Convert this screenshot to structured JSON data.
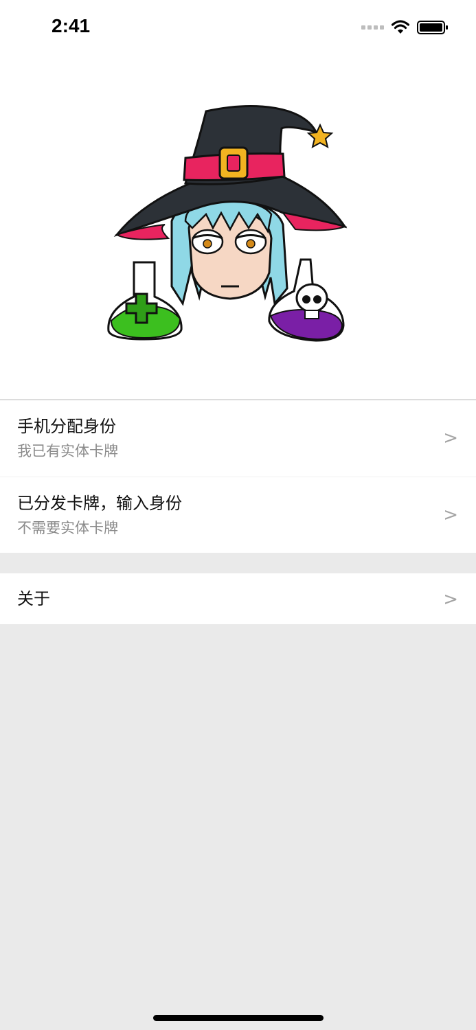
{
  "status_bar": {
    "time": "2:41",
    "icons": [
      "signal-icon",
      "wifi-icon",
      "battery-icon"
    ]
  },
  "hero": {
    "image": "witch-illustration"
  },
  "menu": {
    "group1": [
      {
        "title": "手机分配身份",
        "subtitle": "我已有实体卡牌",
        "chevron": ">"
      },
      {
        "title": "已分发卡牌，输入身份",
        "subtitle": "不需要实体卡牌",
        "chevron": ">"
      }
    ],
    "group2": [
      {
        "title": "关于",
        "chevron": ">"
      }
    ]
  },
  "colors": {
    "background": "#eaeaea",
    "surface": "#ffffff",
    "title_text": "#111111",
    "subtitle_text": "#8a8a8a",
    "chevron": "#a4a4a4"
  }
}
